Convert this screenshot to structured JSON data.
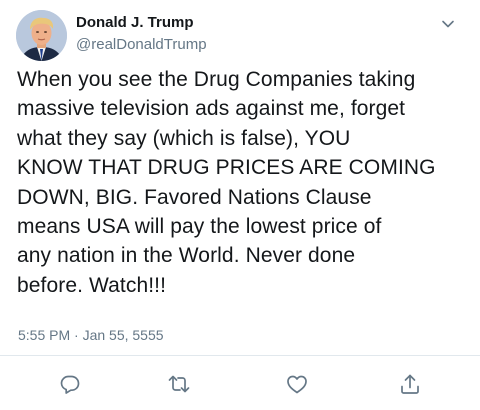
{
  "tweet": {
    "author": {
      "display_name": "Donald J. Trump",
      "handle": "@realDonaldTrump",
      "avatar_icon": "profile-photo"
    },
    "text": "When you see the Drug Companies taking\nmassive  television ads against me, forget\nwhat they say (which is false), YOU\nKNOW THAT DRUG PRICES ARE COMING\nDOWN, BIG. Favored Nations Clause\nmeans USA will pay the lowest price of\nany nation in the World. Never done\nbefore. Watch!!!",
    "timestamp": "5:55 PM · Jan 55, 5555"
  },
  "menu": {
    "caret_icon": "chevron-down-icon"
  },
  "actions": [
    {
      "name": "reply",
      "icon": "reply-icon"
    },
    {
      "name": "retweet",
      "icon": "retweet-icon"
    },
    {
      "name": "like",
      "icon": "heart-icon"
    },
    {
      "name": "share",
      "icon": "share-icon"
    }
  ],
  "colors": {
    "text_primary": "#14171a",
    "text_secondary": "#657786",
    "icon": "#657786",
    "divider": "#e1e8ed"
  }
}
